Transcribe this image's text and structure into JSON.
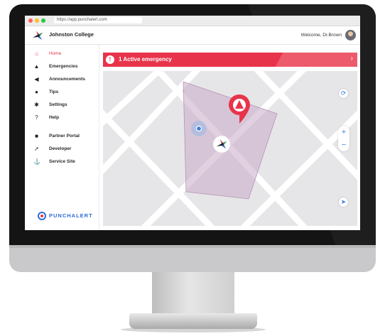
{
  "browser": {
    "url": "https://app.punchalert.com"
  },
  "header": {
    "college": "Johnston College",
    "welcome": "Welcome, Dr.Brown"
  },
  "sidebar": {
    "items": [
      {
        "label": "Home",
        "icon": "home-icon",
        "glyph": "⌂",
        "active": true
      },
      {
        "label": "Emergencies",
        "icon": "emergency-icon",
        "glyph": "▲"
      },
      {
        "label": "Announcements",
        "icon": "megaphone-icon",
        "glyph": "◀"
      },
      {
        "label": "Tips",
        "icon": "pin-icon",
        "glyph": "●"
      },
      {
        "label": "Settings",
        "icon": "gear-icon",
        "glyph": "✱"
      },
      {
        "label": "Help",
        "icon": "help-icon",
        "glyph": "?"
      },
      {
        "label": "Partner Portal",
        "icon": "briefcase-icon",
        "glyph": "■"
      },
      {
        "label": "Developer",
        "icon": "rocket-icon",
        "glyph": "➚"
      },
      {
        "label": "Service Site",
        "icon": "service-icon",
        "glyph": "⚓"
      }
    ]
  },
  "brand": {
    "name": "PUNCHALERT"
  },
  "alert": {
    "text": "1 Active emergency",
    "chevron": "›"
  },
  "map": {
    "zoom_in": "+",
    "zoom_out": "−"
  },
  "colors": {
    "accent": "#e8344a",
    "brand_blue": "#2f6bd6",
    "map_zone": "#c9a9c6",
    "map_bg": "#e6e6e8"
  }
}
